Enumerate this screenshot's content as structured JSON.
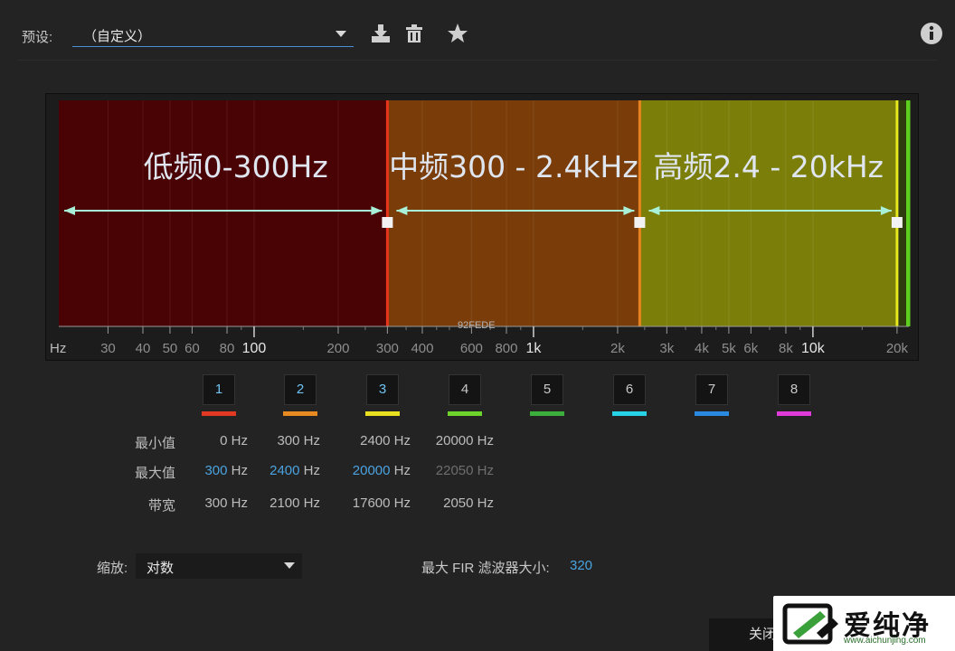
{
  "header": {
    "preset_label": "预设:",
    "preset_value": "（自定义）",
    "icons": [
      "download-icon",
      "trash-icon",
      "star-icon",
      "info-icon"
    ]
  },
  "graph": {
    "annotations": {
      "low": "低频0-300Hz",
      "mid": "中频300 - 2.4kHz",
      "high": "高频2.4 - 20kHz"
    },
    "overlay_text": "92FEDE",
    "x_axis": {
      "scale": "log",
      "range": [
        20,
        22050
      ],
      "major_ticks": [
        {
          "value": 100,
          "label": "100"
        },
        {
          "value": 1000,
          "label": "1k"
        },
        {
          "value": 10000,
          "label": "10k"
        }
      ],
      "minor_ticks": [
        {
          "value": 30,
          "label": "30"
        },
        {
          "value": 40,
          "label": "40"
        },
        {
          "value": 50,
          "label": "50"
        },
        {
          "value": 60,
          "label": "60"
        },
        {
          "value": 80,
          "label": "80"
        },
        {
          "value": 200,
          "label": "200"
        },
        {
          "value": 300,
          "label": "300"
        },
        {
          "value": 400,
          "label": "400"
        },
        {
          "value": 600,
          "label": "600"
        },
        {
          "value": 800,
          "label": "800"
        },
        {
          "value": 2000,
          "label": "2k"
        },
        {
          "value": 3000,
          "label": "3k"
        },
        {
          "value": 4000,
          "label": "4k"
        },
        {
          "value": 5000,
          "label": "5k"
        },
        {
          "value": 6000,
          "label": "6k"
        },
        {
          "value": 8000,
          "label": "8k"
        },
        {
          "value": 20000,
          "label": "20k"
        }
      ],
      "unit_label": "Hz"
    },
    "bands": [
      {
        "min": 20,
        "max": 300,
        "fill": "#4a0305",
        "edge": "#e8351e"
      },
      {
        "min": 300,
        "max": 2400,
        "fill": "#7a3d0a",
        "edge": "#e8821e"
      },
      {
        "min": 2400,
        "max": 20000,
        "fill": "#7c7e0a",
        "edge": "#e8e81e"
      },
      {
        "min": 20000,
        "max": 22050,
        "fill": "#2f3c10",
        "edge": "#5dd01e"
      }
    ],
    "handles": [
      300,
      2400,
      20000
    ]
  },
  "band_buttons": [
    {
      "label": "1",
      "color": "#e23a22",
      "active": true
    },
    {
      "label": "2",
      "color": "#e88a22",
      "active": true
    },
    {
      "label": "3",
      "color": "#e8e020",
      "active": true
    },
    {
      "label": "4",
      "color": "#6cd42a",
      "active": false
    },
    {
      "label": "5",
      "color": "#3cae3c",
      "active": false
    },
    {
      "label": "6",
      "color": "#28d2e6",
      "active": false
    },
    {
      "label": "7",
      "color": "#2a8ae0",
      "active": false
    },
    {
      "label": "8",
      "color": "#e03ad8",
      "active": false
    }
  ],
  "table": {
    "rows": {
      "min_label": "最小值",
      "max_label": "最大值",
      "bw_label": "带宽"
    },
    "unit": "Hz",
    "min": [
      "0",
      "300",
      "2400",
      "20000"
    ],
    "max": [
      "300",
      "2400",
      "20000",
      "22050"
    ],
    "bandwidth": [
      "300",
      "2100",
      "17600",
      "2050"
    ]
  },
  "footer": {
    "scale_label": "缩放:",
    "scale_value": "对数",
    "fir_label": "最大 FIR 滤波器大小:",
    "fir_value": "320",
    "close_label": "关闭",
    "watermark_text": "爱纯净",
    "watermark_url": "www.aichunjing.com"
  }
}
